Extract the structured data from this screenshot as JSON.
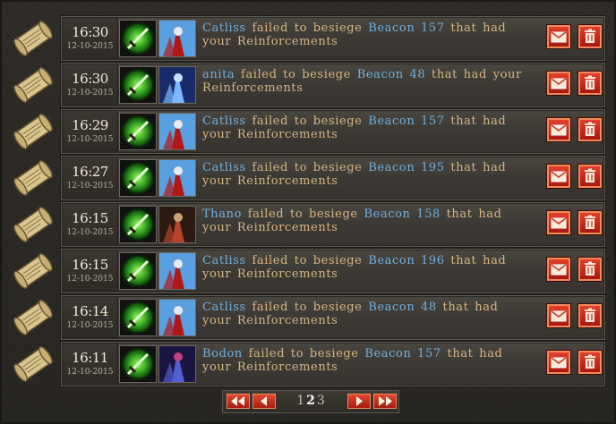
{
  "reports": [
    {
      "time": "16:30",
      "date": "12-10-2015",
      "player": "Catliss",
      "pre": "failed to besiege",
      "target": "Beacon",
      "num": "157",
      "post": "that had your Reinforcements",
      "avatar": "red"
    },
    {
      "time": "16:30",
      "date": "12-10-2015",
      "player": "anita",
      "pre": "failed to besiege",
      "target": "Beacon",
      "num": "48",
      "post": "that had your Reinforcements",
      "avatar": "blue"
    },
    {
      "time": "16:29",
      "date": "12-10-2015",
      "player": "Catliss",
      "pre": "failed to besiege",
      "target": "Beacon",
      "num": "157",
      "post": "that had your Reinforcements",
      "avatar": "red"
    },
    {
      "time": "16:27",
      "date": "12-10-2015",
      "player": "Catliss",
      "pre": "failed to besiege",
      "target": "Beacon",
      "num": "195",
      "post": "that had your Reinforcements",
      "avatar": "red"
    },
    {
      "time": "16:15",
      "date": "12-10-2015",
      "player": "Thano",
      "pre": "failed to besiege",
      "target": "Beacon",
      "num": "158",
      "post": "that had your Reinforcements",
      "avatar": "armor"
    },
    {
      "time": "16:15",
      "date": "12-10-2015",
      "player": "Catliss",
      "pre": "failed to besiege",
      "target": "Beacon",
      "num": "196",
      "post": "that had your Reinforcements",
      "avatar": "red"
    },
    {
      "time": "16:14",
      "date": "12-10-2015",
      "player": "Catliss",
      "pre": "failed to besiege",
      "target": "Beacon",
      "num": "48",
      "post": "that had your Reinforcements",
      "avatar": "red"
    },
    {
      "time": "16:11",
      "date": "12-10-2015",
      "player": "Bodon",
      "pre": "failed to besiege",
      "target": "Beacon",
      "num": "157",
      "post": "that had your Reinforcements",
      "avatar": "purple"
    }
  ],
  "pagination": {
    "pages": [
      "1",
      "2",
      "3"
    ],
    "current": "2"
  },
  "colors": {
    "link": "#6fb0e0",
    "text": "#d7b583",
    "button_red": "#c42a1a"
  },
  "icons": {
    "row_left": "scroll-icon",
    "unit": "green-sword-icon",
    "mail": "envelope-icon",
    "delete": "trash-icon",
    "first": "double-left-arrow-icon",
    "prev": "left-arrow-icon",
    "next": "right-arrow-icon",
    "last": "double-right-arrow-icon"
  }
}
